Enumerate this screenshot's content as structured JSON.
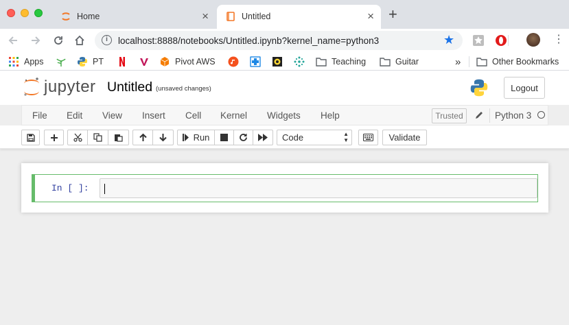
{
  "browser": {
    "tabs": [
      {
        "label": "Home",
        "active": false
      },
      {
        "label": "Untitled",
        "active": true
      }
    ],
    "new_tab": "+",
    "url": "localhost:8888/notebooks/Untitled.ipynb?kernel_name=python3",
    "bookmarks": [
      {
        "label": "Apps",
        "icon": "apps-grid-icon"
      },
      {
        "label": "",
        "icon": "plant-icon"
      },
      {
        "label": "PT",
        "icon": "python-icon"
      },
      {
        "label": "",
        "icon": "netflix-icon"
      },
      {
        "label": "",
        "icon": "v-icon"
      },
      {
        "label": "Pivot AWS",
        "icon": "aws-box-icon"
      },
      {
        "label": "",
        "icon": "music-icon"
      },
      {
        "label": "",
        "icon": "medical-icon"
      },
      {
        "label": "",
        "icon": "badge-icon"
      },
      {
        "label": "",
        "icon": "slack-like-icon"
      },
      {
        "label": "Teaching",
        "icon": "folder-icon"
      },
      {
        "label": "Guitar",
        "icon": "folder-icon"
      }
    ],
    "more_bookmarks": "»",
    "other_bookmarks": "Other Bookmarks"
  },
  "jupyter": {
    "logo_text": "jupyter",
    "notebook_title": "Untitled",
    "save_status": "(unsaved changes)",
    "logout_label": "Logout",
    "menu": [
      "File",
      "Edit",
      "View",
      "Insert",
      "Cell",
      "Kernel",
      "Widgets",
      "Help"
    ],
    "trusted_label": "Trusted",
    "kernel_name": "Python 3",
    "toolbar": {
      "run_label": "Run",
      "cell_type": "Code",
      "validate_label": "Validate"
    },
    "cell": {
      "prompt": "In [ ]:",
      "content": ""
    }
  },
  "colors": {
    "jupyter_orange": "#f37726",
    "cell_border_active": "#66bb6a",
    "prompt_blue": "#303f9f",
    "bookmark_star": "#1a73e8"
  }
}
